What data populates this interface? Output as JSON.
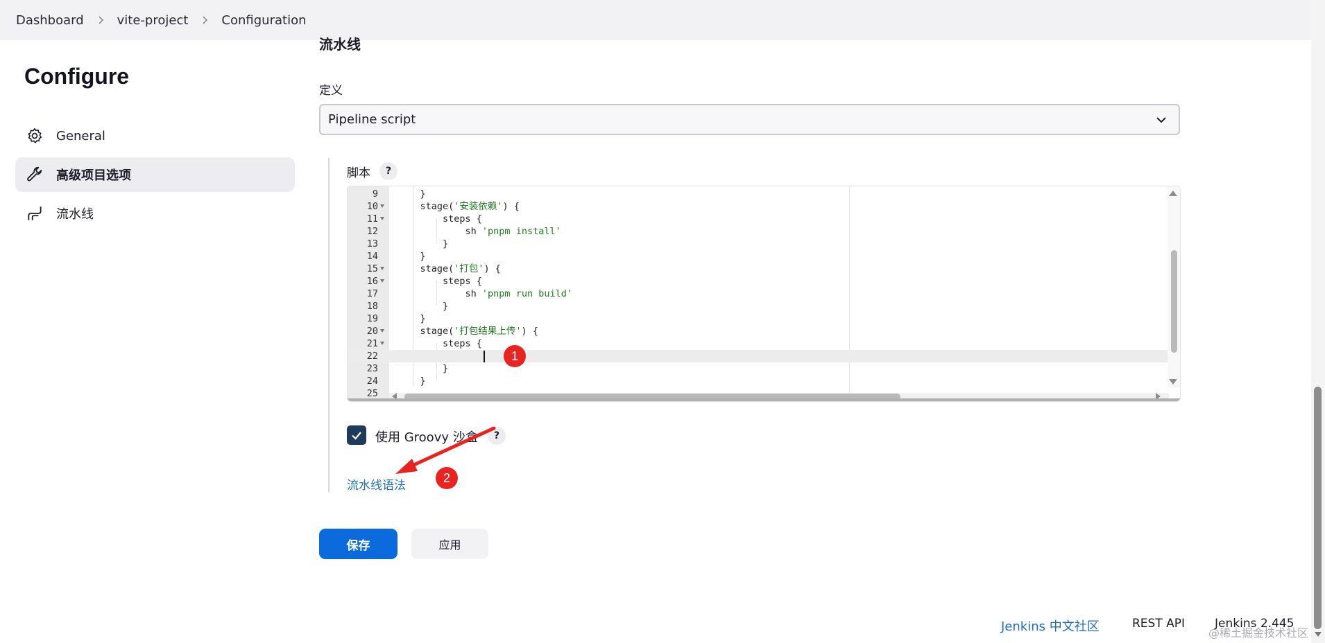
{
  "breadcrumb": {
    "items": [
      "Dashboard",
      "vite-project",
      "Configuration"
    ]
  },
  "sidebar": {
    "title": "Configure",
    "items": [
      {
        "label": "General",
        "icon": "gear-icon",
        "active": false
      },
      {
        "label": "高级项目选项",
        "icon": "wrench-icon",
        "active": true
      },
      {
        "label": "流水线",
        "icon": "pipeline-icon",
        "active": false
      }
    ]
  },
  "main": {
    "section_title": "流水线",
    "definition_label": "定义",
    "definition_value": "Pipeline script",
    "script_label": "脚本",
    "help_symbol": "?",
    "editor": {
      "current_line": 22,
      "lines": [
        {
          "n": "9",
          "fold": false,
          "code": "    }"
        },
        {
          "n": "10",
          "fold": true,
          "code": "    stage('安装依赖') {"
        },
        {
          "n": "11",
          "fold": true,
          "code": "        steps {"
        },
        {
          "n": "12",
          "fold": false,
          "code": "            sh 'pnpm install'"
        },
        {
          "n": "13",
          "fold": false,
          "code": "        }"
        },
        {
          "n": "14",
          "fold": false,
          "code": "    }"
        },
        {
          "n": "15",
          "fold": true,
          "code": "    stage('打包') {"
        },
        {
          "n": "16",
          "fold": true,
          "code": "        steps {"
        },
        {
          "n": "17",
          "fold": false,
          "code": "            sh 'pnpm run build'"
        },
        {
          "n": "18",
          "fold": false,
          "code": "        }"
        },
        {
          "n": "19",
          "fold": false,
          "code": "    }"
        },
        {
          "n": "20",
          "fold": true,
          "code": "    stage('打包结果上传') {"
        },
        {
          "n": "21",
          "fold": true,
          "code": "        steps {"
        },
        {
          "n": "22",
          "fold": false,
          "code": ""
        },
        {
          "n": "23",
          "fold": false,
          "code": "        }"
        },
        {
          "n": "24",
          "fold": false,
          "code": "    }"
        },
        {
          "n": "25",
          "fold": false,
          "code": ""
        }
      ]
    },
    "groovy_sandbox_label": "使用 Groovy 沙盒",
    "groovy_sandbox_checked": true,
    "pipeline_syntax_link": "流水线语法",
    "save_label": "保存",
    "apply_label": "应用"
  },
  "annotations": {
    "marker1": "1",
    "marker2": "2"
  },
  "footer": {
    "community": "Jenkins 中文社区",
    "rest_api": "REST API",
    "version": "Jenkins 2.445",
    "watermark": "@稀土掘金技术社区"
  },
  "colors": {
    "primary_button": "#0b6bdc",
    "link": "#1f6fc1",
    "checkbox": "#1d3b5a",
    "marker": "#e82420",
    "string": "#1e7b1e"
  }
}
